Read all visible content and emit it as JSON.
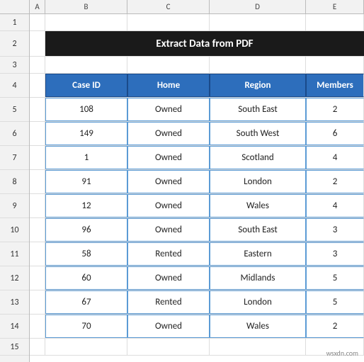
{
  "title": "Extract Data from PDF",
  "columns": {
    "letters": [
      "A",
      "B",
      "C",
      "D",
      "E"
    ],
    "headers": [
      "Case ID",
      "Home",
      "Region",
      "Members"
    ]
  },
  "rows": [
    {
      "row": 1,
      "id": "",
      "home": "",
      "region": "",
      "members": ""
    },
    {
      "row": 2,
      "id": "",
      "home": "",
      "region": "",
      "members": ""
    },
    {
      "row": 3,
      "id": "",
      "home": "",
      "region": "",
      "members": ""
    },
    {
      "row": 4,
      "id": "Case ID",
      "home": "Home",
      "region": "Region",
      "members": "Members"
    },
    {
      "row": 5,
      "id": "108",
      "home": "Owned",
      "region": "South East",
      "members": "2"
    },
    {
      "row": 6,
      "id": "149",
      "home": "Owned",
      "region": "South West",
      "members": "6"
    },
    {
      "row": 7,
      "id": "1",
      "home": "Owned",
      "region": "Scotland",
      "members": "4"
    },
    {
      "row": 8,
      "id": "91",
      "home": "Owned",
      "region": "London",
      "members": "2"
    },
    {
      "row": 9,
      "id": "12",
      "home": "Owned",
      "region": "Wales",
      "members": "4"
    },
    {
      "row": 10,
      "id": "96",
      "home": "Owned",
      "region": "South East",
      "members": "3"
    },
    {
      "row": 11,
      "id": "58",
      "home": "Rented",
      "region": "Eastern",
      "members": "3"
    },
    {
      "row": 12,
      "id": "60",
      "home": "Owned",
      "region": "Midlands",
      "members": "5"
    },
    {
      "row": 13,
      "id": "67",
      "home": "Rented",
      "region": "London",
      "members": "5"
    },
    {
      "row": 14,
      "id": "70",
      "home": "Owned",
      "region": "Wales",
      "members": "2"
    },
    {
      "row": 15,
      "id": "",
      "home": "",
      "region": "",
      "members": ""
    }
  ],
  "watermark": "wsxdn.com"
}
